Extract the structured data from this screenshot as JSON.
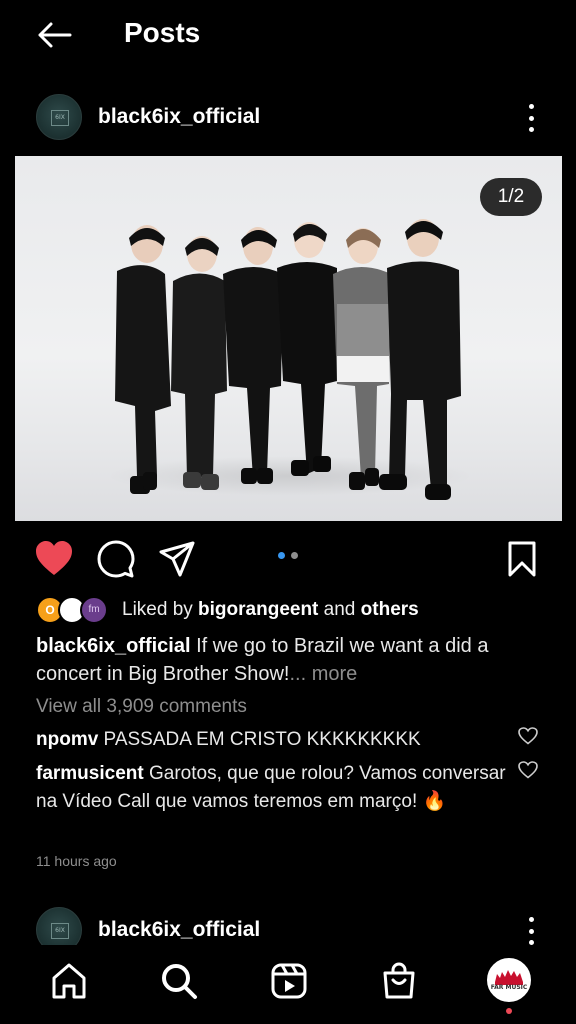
{
  "header": {
    "title": "Posts"
  },
  "post": {
    "username": "black6ix_official",
    "avatar_logo": "6IX",
    "image_counter": "1/2",
    "carousel": {
      "total": 2,
      "current": 1,
      "active_color": "#3897f0",
      "inactive_color": "#8e8e8e"
    },
    "liked_by": {
      "prefix": "Liked by ",
      "user": "bigorangeent",
      "joiner": " and ",
      "others": "others"
    },
    "liker_avatars": [
      {
        "label": "O",
        "color": "#f6a01a"
      },
      {
        "label": "",
        "color": "#ffffff"
      },
      {
        "label": "fm",
        "color": "#6a3d8c"
      }
    ],
    "caption": {
      "username": "black6ix_official",
      "text": " If we go to Brazil we want a did a concert in Big Brother Show!",
      "more": "... more"
    },
    "view_all_comments": "View all 3,909 comments",
    "comments": [
      {
        "username": "npomv",
        "text": " PASSADA EM CRISTO KKKKKKKKK"
      },
      {
        "username": "farmusicent",
        "text": " Garotos, que que rolou? Vamos conversar na Vídeo Call que vamos teremos em março! 🔥"
      }
    ],
    "timestamp": "11 hours ago",
    "liked": true,
    "like_color": "#ed4956"
  },
  "next_post": {
    "username": "black6ix_official",
    "avatar_logo": "6IX"
  },
  "icons": {
    "back": "back-arrow-icon",
    "more": "more-vertical-icon",
    "like": "heart-filled-icon",
    "comment": "comment-bubble-icon",
    "share": "paper-plane-icon",
    "save": "bookmark-icon",
    "home": "home-icon",
    "search": "search-icon",
    "reels": "reels-icon",
    "shop": "shopping-bag-icon",
    "profile": "profile-avatar"
  },
  "bottom_nav": {
    "profile_logo": "FAR MUSIC"
  }
}
